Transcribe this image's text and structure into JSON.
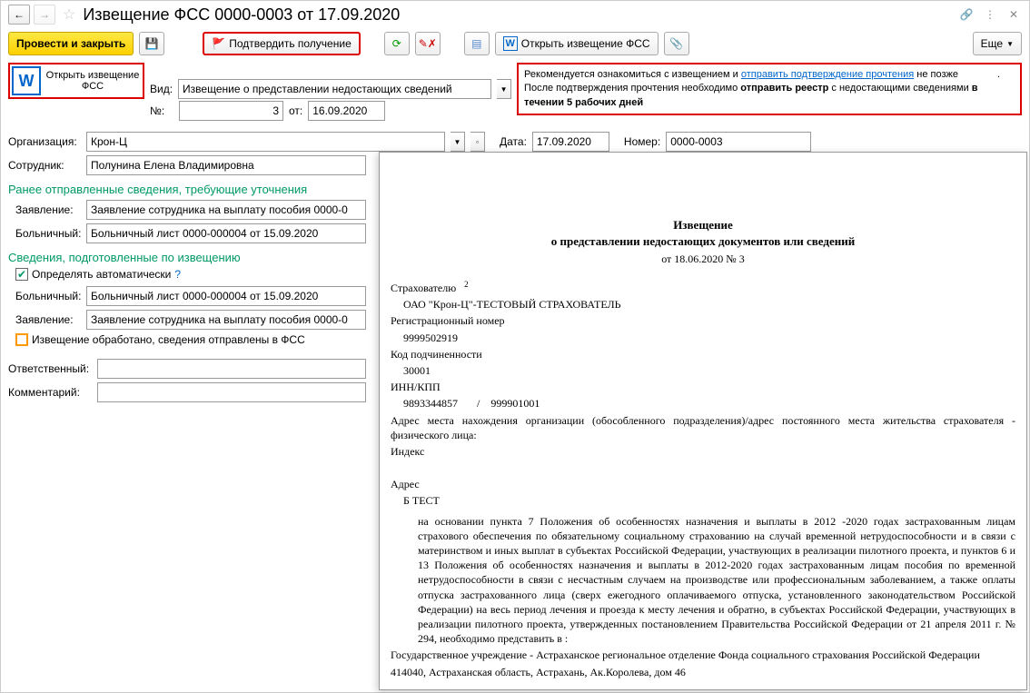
{
  "window": {
    "title": "Извещение ФСС 0000-0003 от 17.09.2020"
  },
  "toolbar": {
    "post_close": "Провести и закрыть",
    "confirm_receipt": "Подтвердить получение",
    "open_fss": "Открыть извещение ФСС",
    "more": "Еще"
  },
  "open_block": {
    "label": "Открыть извещение ФСС"
  },
  "top_form": {
    "vid_label": "Вид:",
    "vid_value": "Извещение о представлении недостающих сведений",
    "num_label": "№:",
    "num_value": "3",
    "ot_label": "от:",
    "ot_value": "16.09.2020"
  },
  "info": {
    "t1": "Рекомендуется ознакомиться с извещением и ",
    "link": "отправить подтверждение прочтения",
    "t2": " не позже ",
    "t3": ". После подтверждения прочтения необходимо ",
    "t4": "отправить реестр",
    "t5": " с недостающими сведениями ",
    "t6": "в течении 5 рабочих дней"
  },
  "form": {
    "org_label": "Организация:",
    "org_value": "Крон-Ц",
    "date_label": "Дата:",
    "date_value": "17.09.2020",
    "num_label": "Номер:",
    "num_value": "0000-0003",
    "emp_label": "Сотрудник:",
    "emp_value": "Полунина Елена Владимировна"
  },
  "section1": {
    "header": "Ранее отправленные сведения, требующие уточнения",
    "app_label": "Заявление:",
    "app_value": "Заявление сотрудника на выплату пособия 0000-0",
    "sick_label": "Больничный:",
    "sick_value": "Больничный лист 0000-000004 от 15.09.2020"
  },
  "section2": {
    "header": "Сведения, подготовленные по извещению",
    "auto_label": "Определять автоматически",
    "sick_label": "Больничный:",
    "sick_value": "Больничный лист 0000-000004 от 15.09.2020",
    "app_label": "Заявление:",
    "app_value": "Заявление сотрудника на выплату пособия 0000-0",
    "processed_label": "Извещение обработано, сведения отправлены в ФСС"
  },
  "footer": {
    "resp_label": "Ответственный:",
    "comment_label": "Комментарий:"
  },
  "doc": {
    "title": "Извещение",
    "subtitle": "о представлении недостающих документов или сведений",
    "date": "от 18.06.2020 № 3",
    "insurer_label": "Страхователю",
    "insurer_sup": "2",
    "insurer_name": "ОАО \"Крон-Ц\"-ТЕСТОВЫЙ СТРАХОВАТЕЛЬ",
    "reg_label": "Регистрационный номер",
    "reg_value": "9999502919",
    "sub_label": "Код подчиненности",
    "sub_value": "30001",
    "inn_label": "ИНН/КПП",
    "inn_value": "9893344857",
    "kpp_value": "999901001",
    "addr_label": "Адрес места нахождения организации (обособленного подразделения)/адрес постоянного места жительства страхователя - физического лица:",
    "index_label": "Индекс",
    "addr2_label": "Адрес",
    "addr2_value": "Б ТЕСТ",
    "body": "на основании пункта 7 Положения об особенностях назначения и выплаты в 2012 -2020 годах застрахованным лицам страхового обеспечения по обязательному социальному страхованию на случай временной нетрудоспособности и в связи с материнством и иных выплат в субъектах Российской Федерации, участвующих в реализации пилотного проекта, и пунктов 6 и 13 Положения об особенностях назначения и выплаты в 2012-2020 годах застрахованным лицам пособия по временной нетрудоспособности в связи с несчастным случаем на производстве или профессиональным заболеванием, а также оплаты отпуска застрахованного лица (сверх ежегодного оплачиваемого отпуска, установленного законодательством Российской Федерации) на весь период лечения и проезда к месту лечения и обратно, в субъектах Российской Федерации, участвующих в реализации пилотного проекта, утвержденных постановлением Правительства Российской Федерации от 21 апреля 2011 г. № 294, необходимо представить в :",
    "gov": "Государственное учреждение - Астраханское региональное отделение Фонда социального страхования Российской Федерации",
    "gov_addr": "414040, Астраханская область, Астрахань, Ак.Королева, дом 46"
  }
}
